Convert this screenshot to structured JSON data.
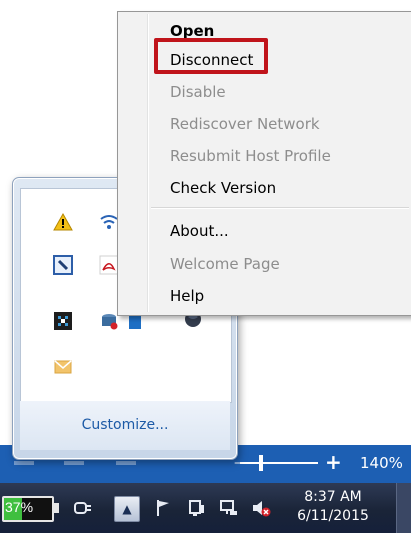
{
  "context_menu": {
    "items": [
      {
        "label": "Open",
        "bold": true,
        "enabled": true
      },
      {
        "label": "Disconnect",
        "bold": false,
        "enabled": true,
        "highlighted": true
      },
      {
        "label": "Disable",
        "bold": false,
        "enabled": false
      },
      {
        "label": "Rediscover Network",
        "bold": false,
        "enabled": false
      },
      {
        "label": "Resubmit Host Profile",
        "bold": false,
        "enabled": false
      },
      {
        "label": "Check Version",
        "bold": false,
        "enabled": true
      },
      {
        "label": "About...",
        "bold": false,
        "enabled": true
      },
      {
        "label": "Welcome Page",
        "bold": false,
        "enabled": false
      },
      {
        "label": "Help",
        "bold": false,
        "enabled": true
      }
    ],
    "highlight_color": "#c0141b"
  },
  "overflow_panel": {
    "customize_label": "Customize...",
    "icons": [
      "warning-icon",
      "wifi-icon",
      "wrench-icon",
      "acrobat-icon",
      "network-icon",
      "drive-icon",
      "bluetooth-icon",
      "globe-icon",
      "mail-icon"
    ]
  },
  "zoom": {
    "percent_label": "140%"
  },
  "taskbar": {
    "battery_label": "37%",
    "battery_level": 0.37,
    "clock_time": "8:37 AM",
    "clock_date": "6/11/2015"
  },
  "colors": {
    "taskbar": "#1a2438",
    "zoom_bar": "#1d5fb3",
    "link": "#1c5aa6"
  }
}
